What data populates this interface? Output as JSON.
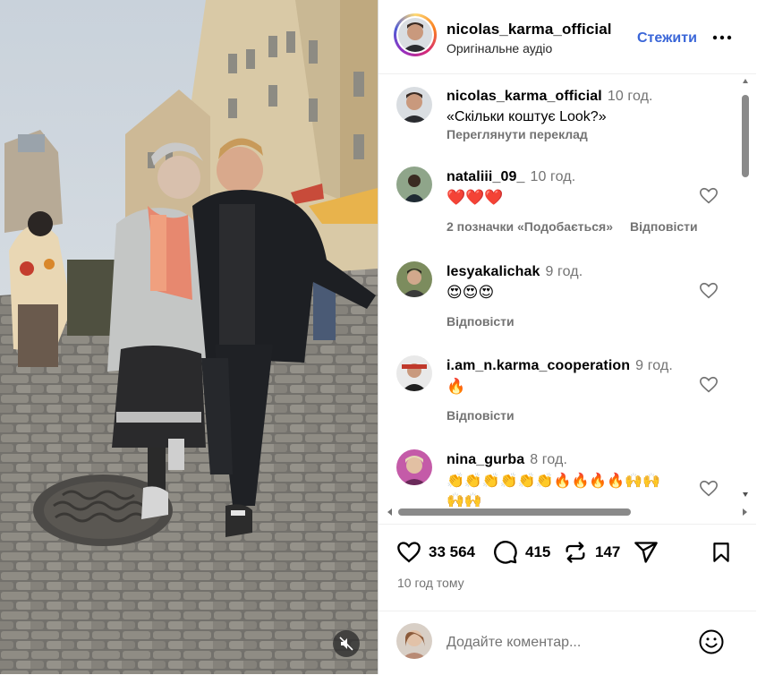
{
  "header": {
    "username": "nicolas_karma_official",
    "audio": "Оригінальне аудіо",
    "follow_label": "Стежити",
    "more_icon": "more-horizontal-icon"
  },
  "caption": {
    "username": "nicolas_karma_official",
    "time": "10 год.",
    "text": "«Скільки коштує Look?»",
    "translate_label": "Переглянути переклад"
  },
  "comments": [
    {
      "username": "nataliii_09_",
      "time": "10 год.",
      "text": "❤️❤️❤️",
      "likes": "2 позначки «Подобається»",
      "reply": "Відповісти"
    },
    {
      "username": "lesyakalichak",
      "time": "9 год.",
      "text": "😍😍😍",
      "reply": "Відповісти"
    },
    {
      "username": "i.am_n.karma_cooperation",
      "time": "9 год.",
      "text": "🔥",
      "reply": "Відповісти"
    },
    {
      "username": "nina_gurba",
      "time": "8 год.",
      "text_line1": "👏👏👏👏👏👏🔥🔥🔥🔥🙌🙌",
      "text_line2": "🙌🙌"
    }
  ],
  "actions": {
    "likes": "33 564",
    "comments": "415",
    "reposts": "147",
    "posted": "10 год тому"
  },
  "composer": {
    "placeholder": "Додайте коментар..."
  },
  "colors": {
    "accent": "#3a66d8",
    "muted": "#737373",
    "heart_red": "#e0245e"
  }
}
